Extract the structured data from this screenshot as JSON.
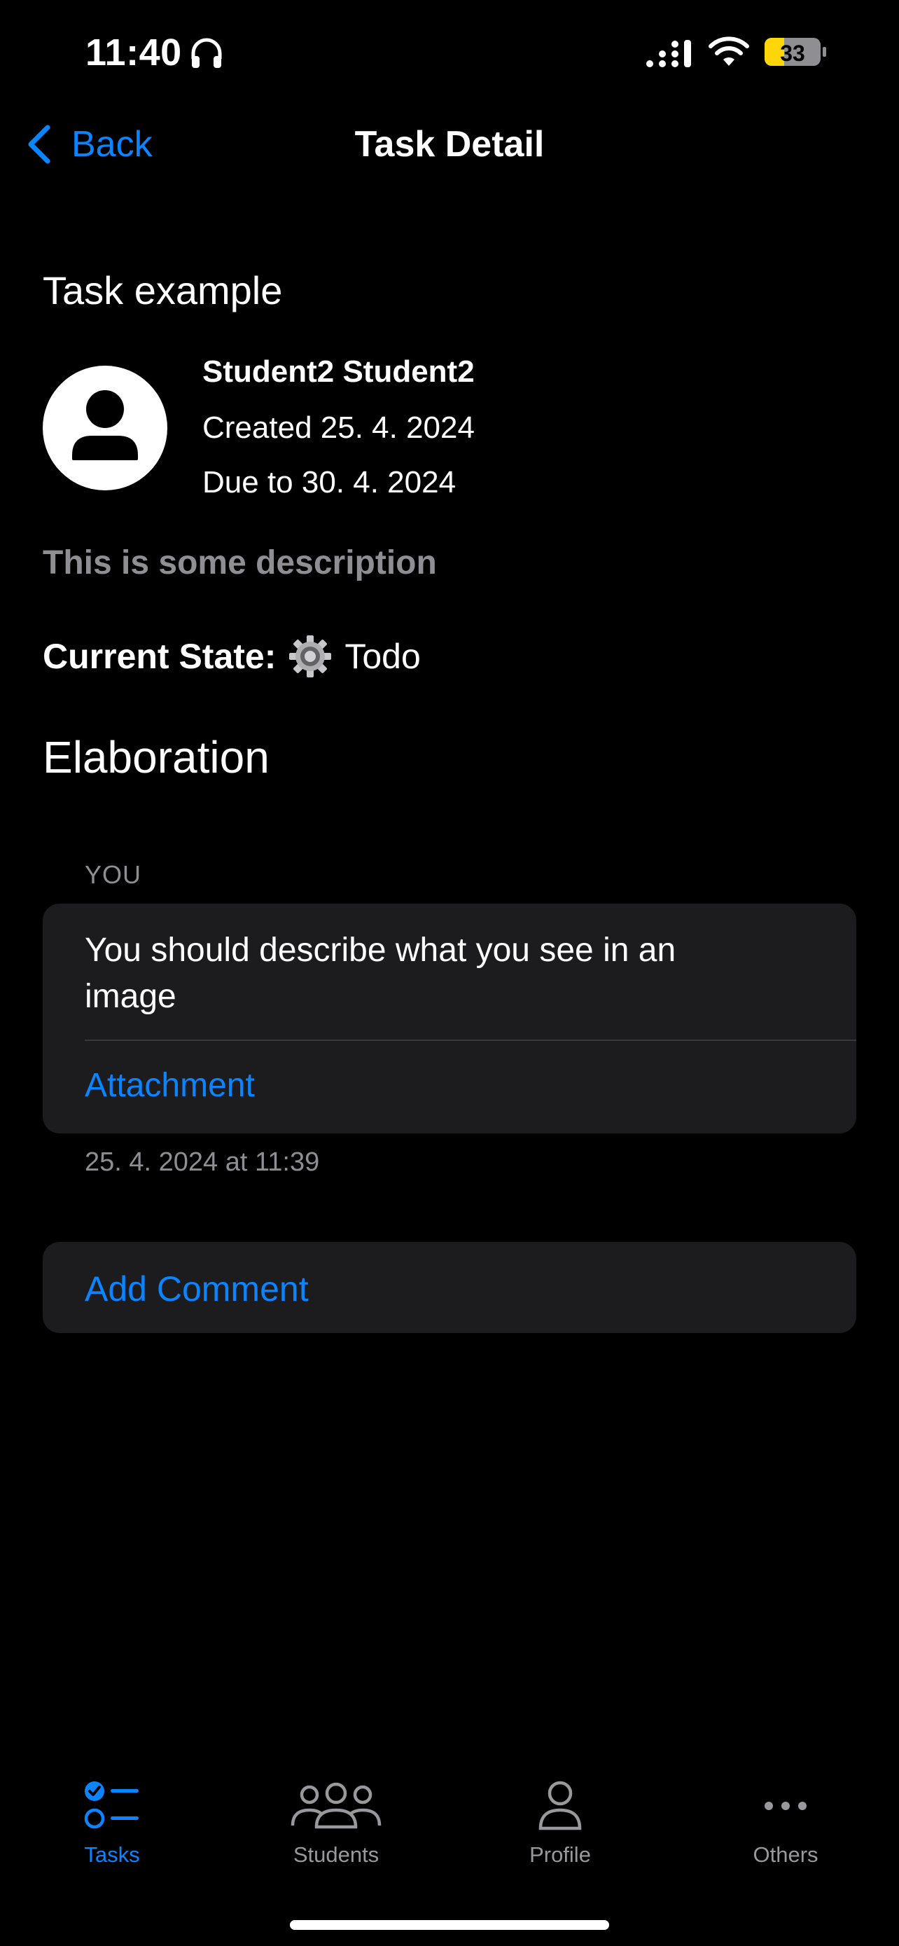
{
  "status_bar": {
    "time": "11:40",
    "battery_level": "33"
  },
  "nav": {
    "back_label": "Back",
    "title": "Task Detail"
  },
  "task": {
    "title": "Task example",
    "author": "Student2 Student2",
    "created": "Created 25. 4. 2024",
    "due": "Due to 30. 4. 2024",
    "description": "This is some description",
    "state_label": "Current State:",
    "state_value": "Todo",
    "state_icon": "gear-icon"
  },
  "elaboration": {
    "section_title": "Elaboration",
    "comment": {
      "author": "YOU",
      "text": "You should describe what you see in an image",
      "attachment_label": "Attachment",
      "timestamp": "25. 4. 2024 at 11:39"
    },
    "add_comment_label": "Add Comment"
  },
  "tab_bar": {
    "items": [
      {
        "label": "Tasks",
        "icon": "tasks-icon",
        "active": true
      },
      {
        "label": "Students",
        "icon": "students-icon",
        "active": false
      },
      {
        "label": "Profile",
        "icon": "profile-icon",
        "active": false
      },
      {
        "label": "Others",
        "icon": "ellipsis-icon",
        "active": false
      }
    ]
  },
  "colors": {
    "accent": "#0a84ff",
    "background": "#000000",
    "card": "#1c1c1e",
    "secondary_text": "#8e8e93",
    "battery": "#ffd60a"
  }
}
